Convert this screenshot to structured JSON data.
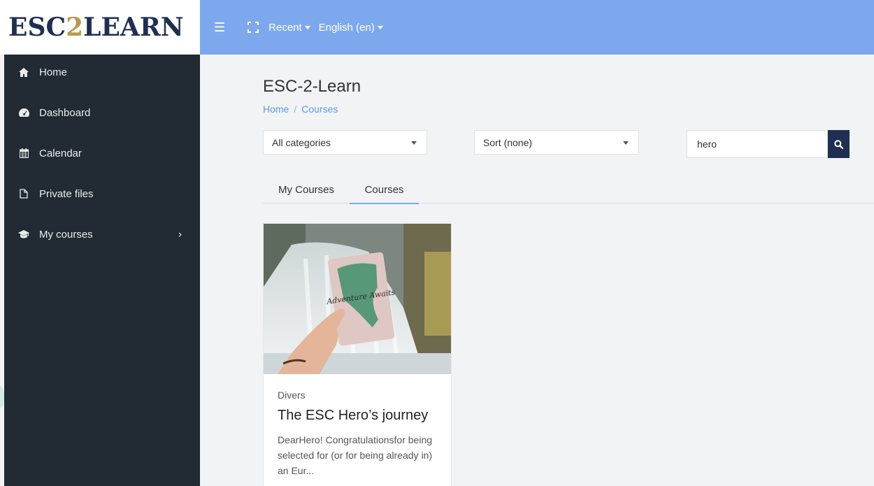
{
  "logo": {
    "part1": "ESC",
    "part2": "2",
    "part3": "LEARN"
  },
  "topbar": {
    "recent": "Recent",
    "language": "English (en)"
  },
  "sidebar": {
    "items": [
      {
        "label": "Home",
        "icon": "home-icon"
      },
      {
        "label": "Dashboard",
        "icon": "dashboard-icon"
      },
      {
        "label": "Calendar",
        "icon": "calendar-icon"
      },
      {
        "label": "Private files",
        "icon": "file-icon"
      },
      {
        "label": "My courses",
        "icon": "graduation-cap-icon"
      }
    ]
  },
  "main": {
    "title": "ESC-2-Learn",
    "breadcrumb": {
      "home": "Home",
      "separator": "/",
      "current": "Courses"
    },
    "filters": {
      "category": "All categories",
      "sort": "Sort (none)",
      "search_value": "hero"
    },
    "tabs": [
      {
        "label": "My Courses"
      },
      {
        "label": "Courses"
      }
    ],
    "course": {
      "category": "Divers",
      "title": "The ESC Hero’s journey",
      "description": "DearHero! Congratulationsfor being selected for (or for being already in) an Eur...",
      "image_text": "Adventure Awaits"
    }
  },
  "colors": {
    "topbar": "#7ea8ee",
    "sidebar": "#222b33",
    "navy": "#1f2f52",
    "gold": "#b89a4e",
    "link": "#5b9be8"
  }
}
